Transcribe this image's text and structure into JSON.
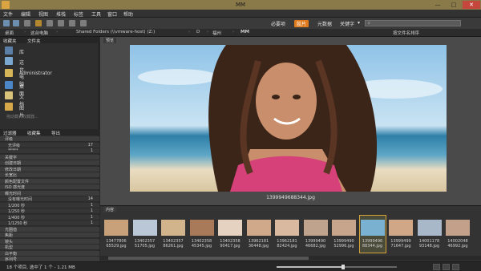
{
  "window": {
    "title": "MM",
    "min_glyph": "—",
    "max_glyph": "□",
    "close_glyph": "✕"
  },
  "menu": [
    "文件",
    "编辑",
    "视图",
    "堆栈",
    "标签",
    "工具",
    "窗口",
    "帮助"
  ],
  "toolbar": {
    "workspaces": [
      "必要项",
      "胶片",
      "元数据",
      "关键字"
    ],
    "active_workspace": "胶片",
    "workspace_menu": "▾",
    "search_placeholder": "",
    "search_glyph": "⌕"
  },
  "path": {
    "crumbs": [
      "桌面",
      "这台电脑",
      "Shared Folders (\\\\vmware-host) (Z:)",
      "D",
      "福州",
      "MM"
    ],
    "sort_label": "按文件名排序"
  },
  "left_panel": {
    "tabs": [
      "收藏夹",
      "文件夹"
    ],
    "favorites": [
      {
        "label": "库",
        "icon": "library-icon"
      },
      {
        "label": "这台电脑",
        "icon": "computer-icon"
      },
      {
        "label": "Administrator",
        "icon": "user-folder-icon"
      },
      {
        "label": "桌面",
        "icon": "desktop-icon"
      },
      {
        "label": "文档",
        "icon": "documents-icon"
      },
      {
        "label": "图片",
        "icon": "pictures-icon"
      }
    ],
    "drag_hint": "拖动藏夹收藏器...",
    "filter_tabs": [
      "过滤器",
      "收藏集",
      "导出"
    ],
    "filter_rows": [
      {
        "label": "评级",
        "count": "",
        "head": true
      },
      {
        "label": "无评级",
        "count": "17",
        "head": false
      },
      {
        "label": "*****",
        "count": "1",
        "head": false
      },
      {
        "label": "关键字",
        "count": "",
        "head": true
      },
      {
        "label": "创建日期",
        "count": "",
        "head": true
      },
      {
        "label": "修改日期",
        "count": "",
        "head": true
      },
      {
        "label": "长宽比",
        "count": "",
        "head": true
      },
      {
        "label": "颜色配置文件",
        "count": "",
        "head": true
      },
      {
        "label": "ISO 感光度",
        "count": "",
        "head": true
      },
      {
        "label": "曝光时间",
        "count": "",
        "head": true
      },
      {
        "label": "没有曝光时间",
        "count": "14",
        "head": false
      },
      {
        "label": "1/200 秒",
        "count": "1",
        "head": false
      },
      {
        "label": "1/250 秒",
        "count": "1",
        "head": false
      },
      {
        "label": "1/400 秒",
        "count": "1",
        "head": false
      },
      {
        "label": "1/1250 秒",
        "count": "1",
        "head": false
      },
      {
        "label": "光圈值",
        "count": "",
        "head": true
      },
      {
        "label": "焦距",
        "count": "",
        "head": true
      },
      {
        "label": "镜头",
        "count": "",
        "head": true
      },
      {
        "label": "机型",
        "count": "",
        "head": true
      },
      {
        "label": "白平衡",
        "count": "",
        "head": true
      },
      {
        "label": "序列号",
        "count": "",
        "head": true
      }
    ]
  },
  "preview": {
    "tab_label": "预览",
    "filename": "1399949688344.jpg"
  },
  "filmstrip": {
    "tab_label": "内容",
    "thumbs": [
      "13477806\n65529.jpg",
      "13402357\n51705.jpg",
      "13402357\n86261.jpg",
      "13402358\n45345.jpg",
      "13402358\n90417.jpg",
      "13962181\n36448.jpg",
      "13962181\n82424.jpg",
      "13999490\n46682.jpg",
      "13999490\n52996.jpg",
      "13999496\n88344.jpg",
      "13999499\n71647.jpg",
      "14001178\n93148.jpg",
      "14002048\n46992.jpg"
    ],
    "selected_index": 9
  },
  "status": {
    "text": "18 个项目, 选中了 1 个 - 1.21 MB",
    "zoom_fraction": 0.55
  },
  "colors": {
    "accent": "#e07a1c",
    "selection": "#d4a43a",
    "titlebar": "#8a7a4a",
    "close": "#c4463c"
  }
}
